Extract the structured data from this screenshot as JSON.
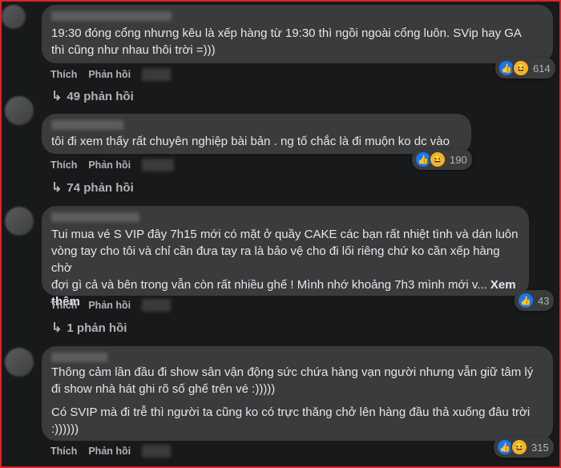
{
  "comments": [
    {
      "lines": [
        "19:30 đóng cổng nhưng kêu là xếp hàng từ 19:30 thì ngồi ngoài cổng luôn. SVip hay GA",
        "thì cũng như nhau thôi trời =)))"
      ],
      "like_label": "Thích",
      "reply_label": "Phản hồi",
      "reaction_count": "614",
      "reactions": [
        "like-icon",
        "haha-icon"
      ],
      "replies_text": "49 phản hồi"
    },
    {
      "lines": [
        "tôi đi xem thấy rất chuyên nghiệp bài bản . ng tố chắc là đi muộn ko dc vào"
      ],
      "like_label": "Thích",
      "reply_label": "Phản hồi",
      "reaction_count": "190",
      "reactions": [
        "like-icon",
        "haha-icon"
      ],
      "replies_text": "74 phản hồi"
    },
    {
      "lines": [
        "Tui mua vé S VIP đây 7h15 mới có mặt ở quầy CAKE các bạn rất nhiệt tình và dán luôn",
        "vòng tay cho tôi và chỉ cần đưa tay ra là bảo vệ cho đi lối riêng chứ ko cần xếp hàng chờ",
        "đợi gì cả và bên trong vẫn còn rất nhiều ghế ! Mình nhớ khoảng 7h3 mình mới v..."
      ],
      "see_more_tail": "Xem",
      "see_more_line": "thêm",
      "like_label": "Thích",
      "reply_label": "Phản hồi",
      "reaction_count": "43",
      "reactions": [
        "like-icon"
      ],
      "replies_text": "1 phản hồi"
    },
    {
      "lines": [
        "Thông cảm lần đầu đi show sân vận động sức chứa hàng vạn người nhưng vẫn giữ tâm lý",
        "đi show nhà hát ghi rõ số ghế trên vé :)))))"
      ],
      "lines2": [
        "Có SVIP mà đi trễ thì người ta cũng ko có trực thăng chở lên hàng đầu thả xuống đâu trời",
        ":))))))"
      ],
      "like_label": "Thích",
      "reply_label": "Phản hồi",
      "reaction_count": "315",
      "reactions": [
        "like-icon",
        "haha-icon"
      ]
    }
  ],
  "colors": {
    "background": "#18191a",
    "bubble": "#3a3b3c",
    "text": "#e4e6eb",
    "muted": "#b0b3b8",
    "border": "#d8232a",
    "like": "#1877f2",
    "haha": "#f7b125"
  }
}
